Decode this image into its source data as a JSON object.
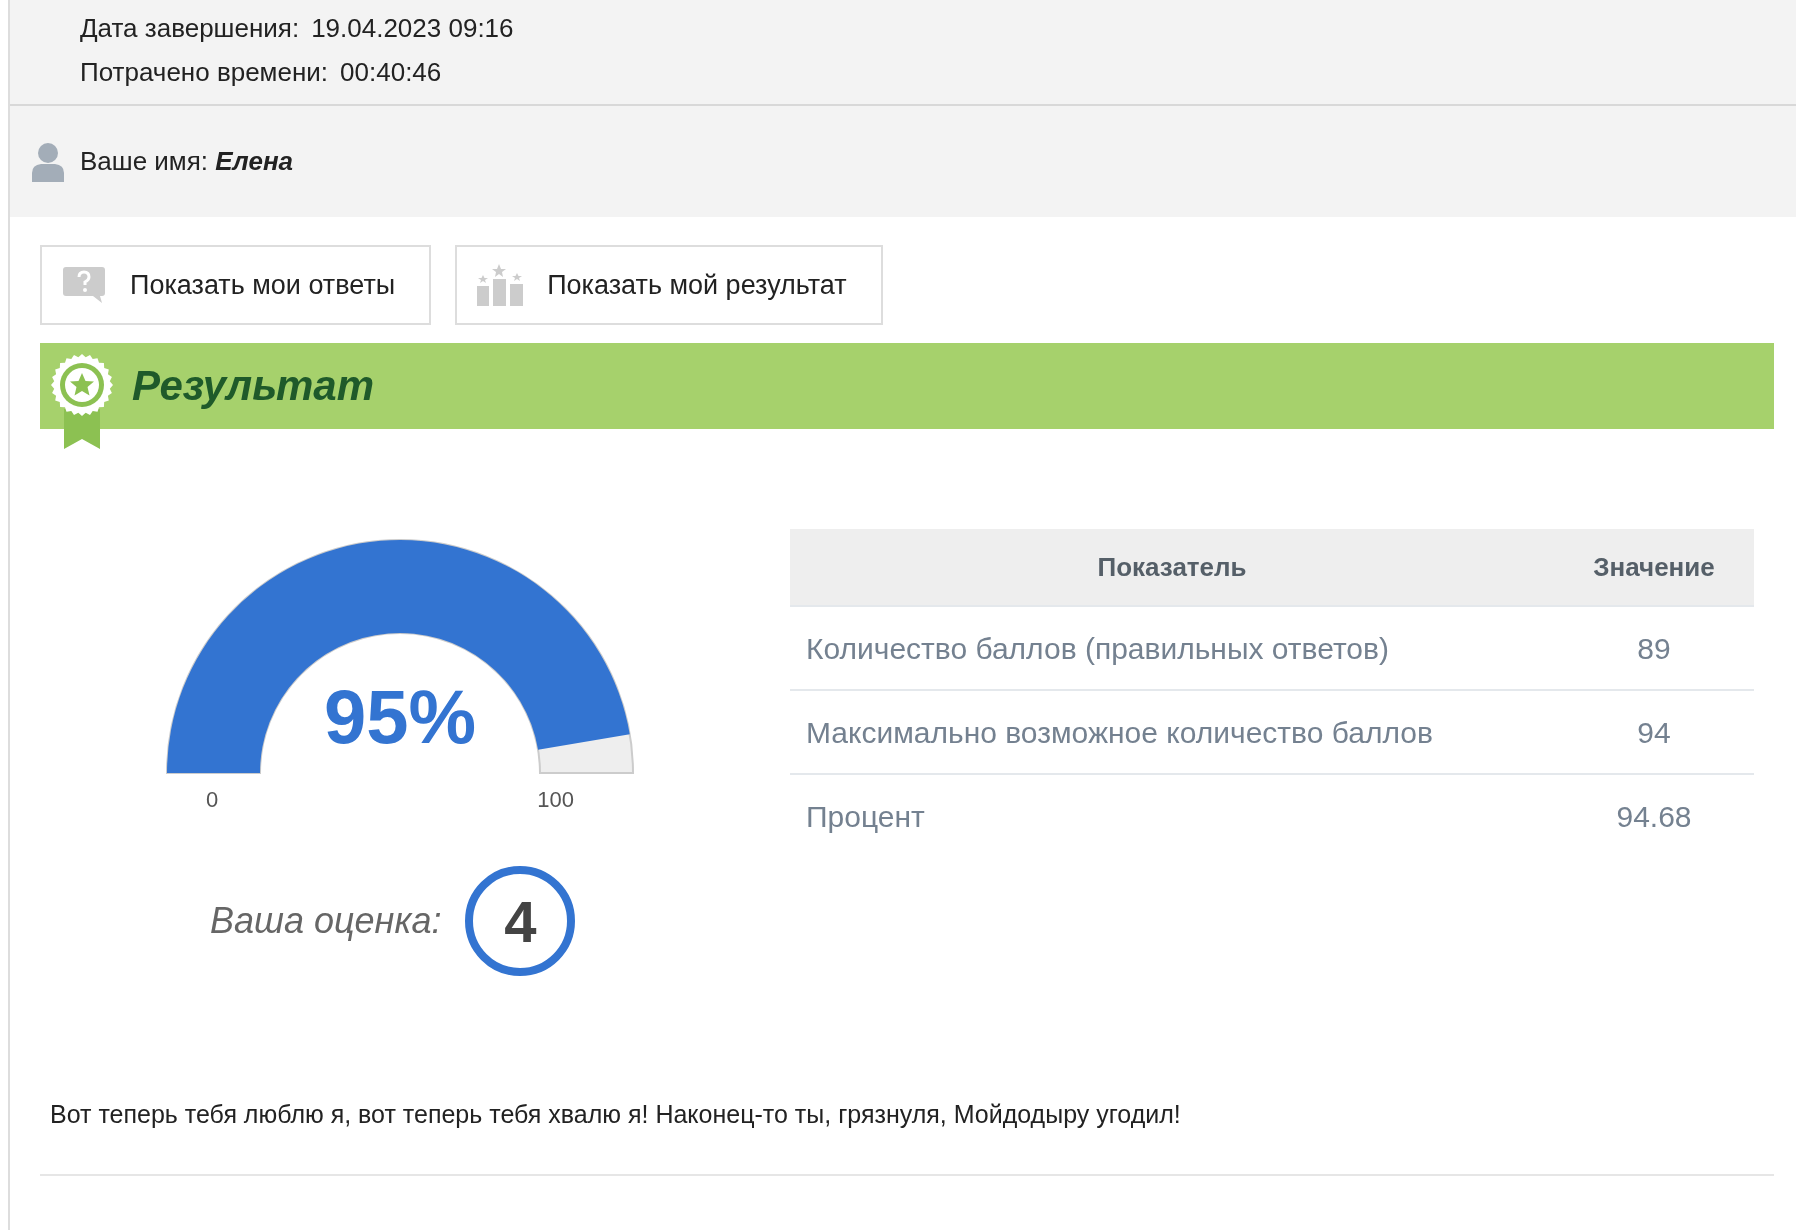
{
  "details": [
    {
      "label": "Дата завершения:",
      "value": "19.04.2023 09:16"
    },
    {
      "label": "Потрачено времени:",
      "value": "00:40:46"
    }
  ],
  "user": {
    "label": "Ваше имя:",
    "name": "Елена"
  },
  "buttons": [
    {
      "label": "Показать мои ответы",
      "kind": "question"
    },
    {
      "label": "Показать мой результат",
      "kind": "podium"
    }
  ],
  "result": {
    "title": "Результат",
    "gauge": {
      "level": 0.9468,
      "value_text": "95%",
      "min_label": "0",
      "max_label": "100"
    },
    "grade_label": "Ваша оценка:",
    "grade": "4",
    "table": {
      "columns": [
        "Показатель",
        "Значение"
      ],
      "rows": [
        {
          "metric": "Количество баллов (правильных ответов)",
          "value": "89"
        },
        {
          "metric": "Максимально возможное количество баллов",
          "value": "94"
        },
        {
          "metric": "Процент",
          "value": "94.68"
        }
      ]
    },
    "message": "Вот теперь тебя люблю я, вот теперь тебя хвалю я! Наконец-то ты, грязнуля, Мойдодыру угодил!"
  }
}
